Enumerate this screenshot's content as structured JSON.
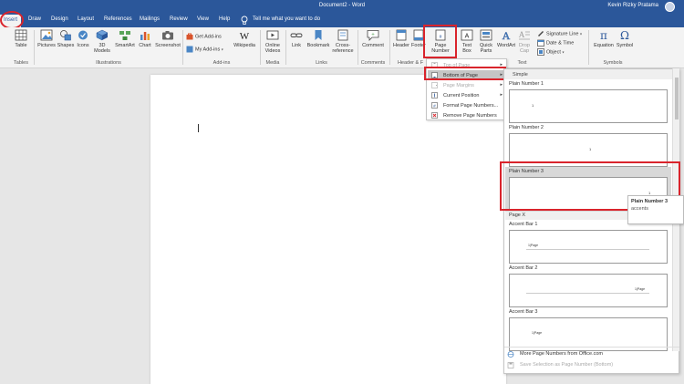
{
  "title": {
    "document": "Document2 - Word",
    "user": "Kevin Rizky Pratama"
  },
  "tabs": {
    "file": "File",
    "insert": "Insert",
    "draw": "Draw",
    "design": "Design",
    "layout": "Layout",
    "references": "References",
    "mailings": "Mailings",
    "review": "Review",
    "view": "View",
    "help": "Help",
    "tell_me": "Tell me what you want to do"
  },
  "ribbon": {
    "table": "Table",
    "tables_group": "Tables",
    "pictures": "Pictures",
    "shapes": "Shapes",
    "icons": "Icons",
    "models_3d_1": "3D",
    "models_3d_2": "Models",
    "smartart": "SmartArt",
    "chart": "Chart",
    "screenshot": "Screenshot",
    "illustrations_group": "Illustrations",
    "get_addins": "Get Add-ins",
    "my_addins": "My Add-ins",
    "wikipedia": "Wikipedia",
    "addins_group": "Add-ins",
    "online_video_1": "Online",
    "online_video_2": "Videos",
    "media_group": "Media",
    "link": "Link",
    "bookmark": "Bookmark",
    "crossref_1": "Cross-",
    "crossref_2": "reference",
    "links_group": "Links",
    "comment": "Comment",
    "comments_group": "Comments",
    "header": "Header",
    "footer": "Footer",
    "header_footer_group": "Header & F",
    "page_number_1": "Page",
    "page_number_2": "Number",
    "textbox_1": "Text",
    "textbox_2": "Box",
    "quickparts_1": "Quick",
    "quickparts_2": "Parts",
    "wordart": "WordArt",
    "dropcap_1": "Drop",
    "dropcap_2": "Cap",
    "text_group": "Text",
    "signature_line": "Signature Line",
    "date_time": "Date & Time",
    "object": "Object",
    "equation": "Equation",
    "symbol": "Symbol",
    "symbols_group": "Symbols"
  },
  "menu": {
    "items": [
      "Top of Page",
      "Bottom of Page",
      "Page Margins",
      "Current Position",
      "Format Page Numbers...",
      "Remove Page Numbers"
    ]
  },
  "gallery": {
    "header": "Simple",
    "items": [
      "Plain Number 1",
      "Plain Number 2",
      "Plain Number 3",
      "Page X",
      "Accent Bar 1",
      "Accent Bar 2",
      "Accent Bar 3"
    ],
    "page_number_glyph": "1",
    "accent_text": "1|Page",
    "more_link": "More Page Numbers from Office.com",
    "save_selection": "Save Selection as Page Number (Bottom)"
  },
  "tooltip": {
    "title": "Plain Number 3",
    "description": "accents"
  },
  "colors": {
    "title_bar": "#2b579a",
    "highlight": "#d9242c",
    "hover": "#c5c5c5"
  }
}
